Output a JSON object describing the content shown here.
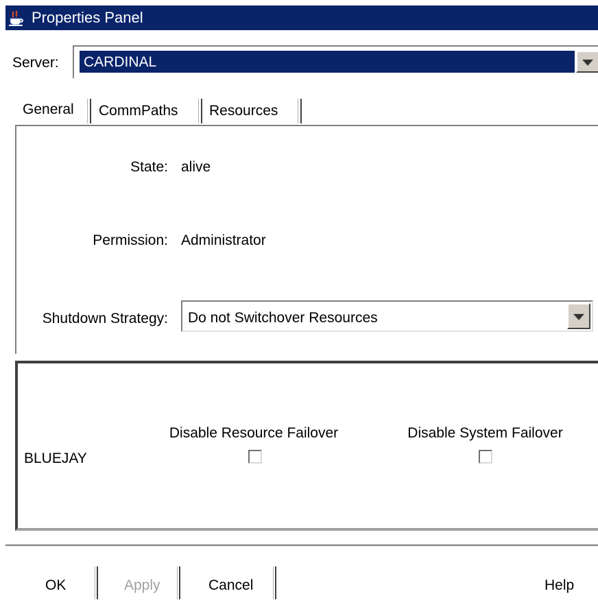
{
  "window": {
    "title": "Properties Panel",
    "icon": "java-cup-icon"
  },
  "server": {
    "label": "Server:",
    "value": "CARDINAL",
    "highlight_color": "#0a246a"
  },
  "tabs": [
    {
      "label": "General",
      "selected": true
    },
    {
      "label": "CommPaths",
      "selected": false
    },
    {
      "label": "Resources",
      "selected": false
    }
  ],
  "general": {
    "state_label": "State:",
    "state_value": "alive",
    "permission_label": "Permission:",
    "permission_value": "Administrator",
    "shutdown_label": "Shutdown Strategy:",
    "shutdown_value": "Do not Switchover Resources"
  },
  "failover": {
    "columns": [
      "Disable Resource Failover",
      "Disable System Failover"
    ],
    "rows": [
      {
        "name": "BLUEJAY",
        "disable_resource_failover": false,
        "disable_system_failover": false
      }
    ]
  },
  "buttons": {
    "ok": "OK",
    "apply": "Apply",
    "cancel": "Cancel",
    "help": "Help"
  },
  "colors": {
    "titlebar": "#0a246a",
    "disabled_text": "#a0a0a0"
  }
}
